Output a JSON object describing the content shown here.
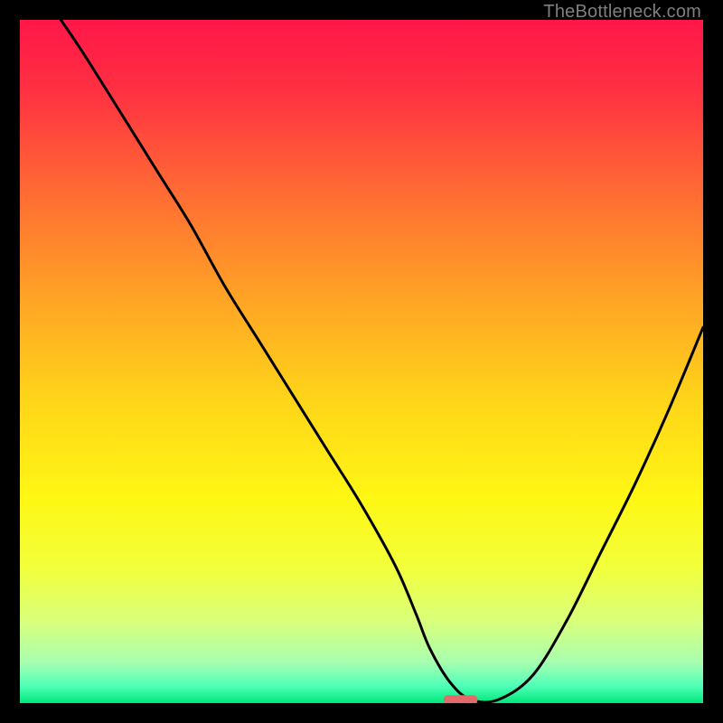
{
  "watermark": "TheBottleneck.com",
  "chart_data": {
    "type": "line",
    "title": "",
    "xlabel": "",
    "ylabel": "",
    "xlim": [
      0,
      100
    ],
    "ylim": [
      0,
      100
    ],
    "grid": false,
    "series": [
      {
        "name": "bottleneck-curve",
        "x": [
          6,
          10,
          20,
          25,
          30,
          35,
          40,
          45,
          50,
          55,
          58,
          60,
          63,
          66,
          70,
          75,
          80,
          85,
          90,
          95,
          100
        ],
        "values": [
          100,
          94,
          78,
          70,
          61,
          53,
          45,
          37,
          29,
          20,
          13,
          8,
          3,
          0.5,
          0.5,
          4,
          12,
          22,
          32,
          43,
          55
        ]
      }
    ],
    "marker": {
      "x_start": 62,
      "x_end": 67,
      "y": 0.5
    },
    "gradient_stops": [
      {
        "pos": 0.0,
        "color": "#ff1749"
      },
      {
        "pos": 0.1,
        "color": "#ff2f42"
      },
      {
        "pos": 0.25,
        "color": "#ff6a34"
      },
      {
        "pos": 0.4,
        "color": "#ffa126"
      },
      {
        "pos": 0.55,
        "color": "#ffd31a"
      },
      {
        "pos": 0.7,
        "color": "#fff714"
      },
      {
        "pos": 0.8,
        "color": "#f2ff3a"
      },
      {
        "pos": 0.88,
        "color": "#d9ff7a"
      },
      {
        "pos": 0.94,
        "color": "#a8ffb0"
      },
      {
        "pos": 0.975,
        "color": "#4fffb8"
      },
      {
        "pos": 1.0,
        "color": "#00e879"
      }
    ],
    "marker_color": "#e26a6a",
    "curve_color": "#000000"
  }
}
